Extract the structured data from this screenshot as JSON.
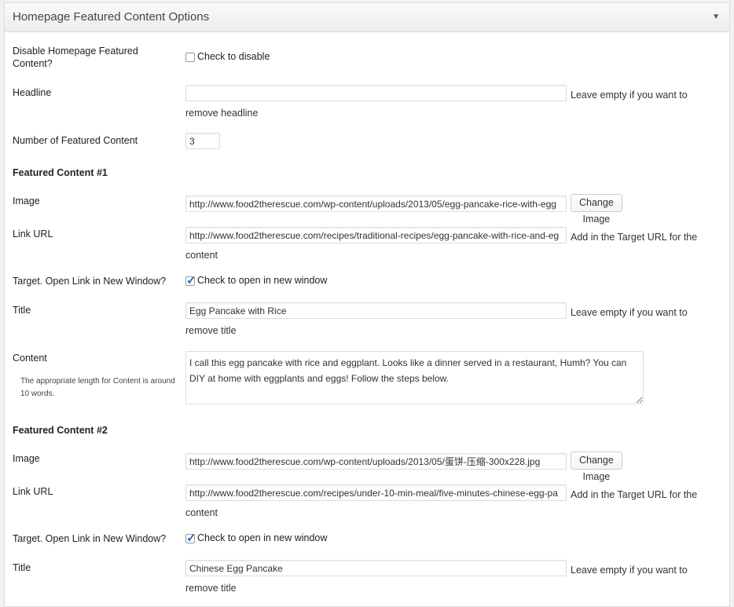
{
  "panel": {
    "title": "Homepage Featured Content Options",
    "toggle_icon": "▼"
  },
  "disable": {
    "label": "Disable Homepage Featured Content?",
    "checkbox_label": "Check to disable",
    "checked": false
  },
  "headline": {
    "label": "Headline",
    "value": "",
    "desc": "Leave empty if you want to remove headline"
  },
  "count": {
    "label": "Number of Featured Content",
    "value": "3"
  },
  "fc1": {
    "heading": "Featured Content #1",
    "image_label": "Image",
    "image_value": "http://www.food2therescue.com/wp-content/uploads/2013/05/egg-pancake-rice-with-egg",
    "change_image": "Change Image",
    "link_label": "Link URL",
    "link_value": "http://www.food2therescue.com/recipes/traditional-recipes/egg-pancake-with-rice-and-eg",
    "link_desc": "Add in the Target URL for the content",
    "target_label": "Target. Open Link in New Window?",
    "target_checkbox_label": "Check to open in new window",
    "target_checked": true,
    "title_label": "Title",
    "title_value": "Egg Pancake with Rice",
    "title_desc": "Leave empty if you want to remove title",
    "content_label": "Content",
    "content_help": "The appropriate length for Content is around 10 words.",
    "content_value": "I call this egg pancake with rice and eggplant. Looks like a dinner served in a restaurant, Humh? You can DIY at home with eggplants and eggs! Follow the steps below."
  },
  "fc2": {
    "heading": "Featured Content #2",
    "image_label": "Image",
    "image_value": "http://www.food2therescue.com/wp-content/uploads/2013/05/蛋饼-压缩-300x228.jpg",
    "change_image": "Change Image",
    "link_label": "Link URL",
    "link_value": "http://www.food2therescue.com/recipes/under-10-min-meal/five-minutes-chinese-egg-pa",
    "link_desc": "Add in the Target URL for the content",
    "target_label": "Target. Open Link in New Window?",
    "target_checkbox_label": "Check to open in new window",
    "target_checked": true,
    "title_label": "Title",
    "title_value": "Chinese Egg Pancake",
    "title_desc": "Leave empty if you want to remove title"
  },
  "colors": {
    "checkbox_accent": "#1e6cc8",
    "panel_border": "#dcdcdc"
  }
}
